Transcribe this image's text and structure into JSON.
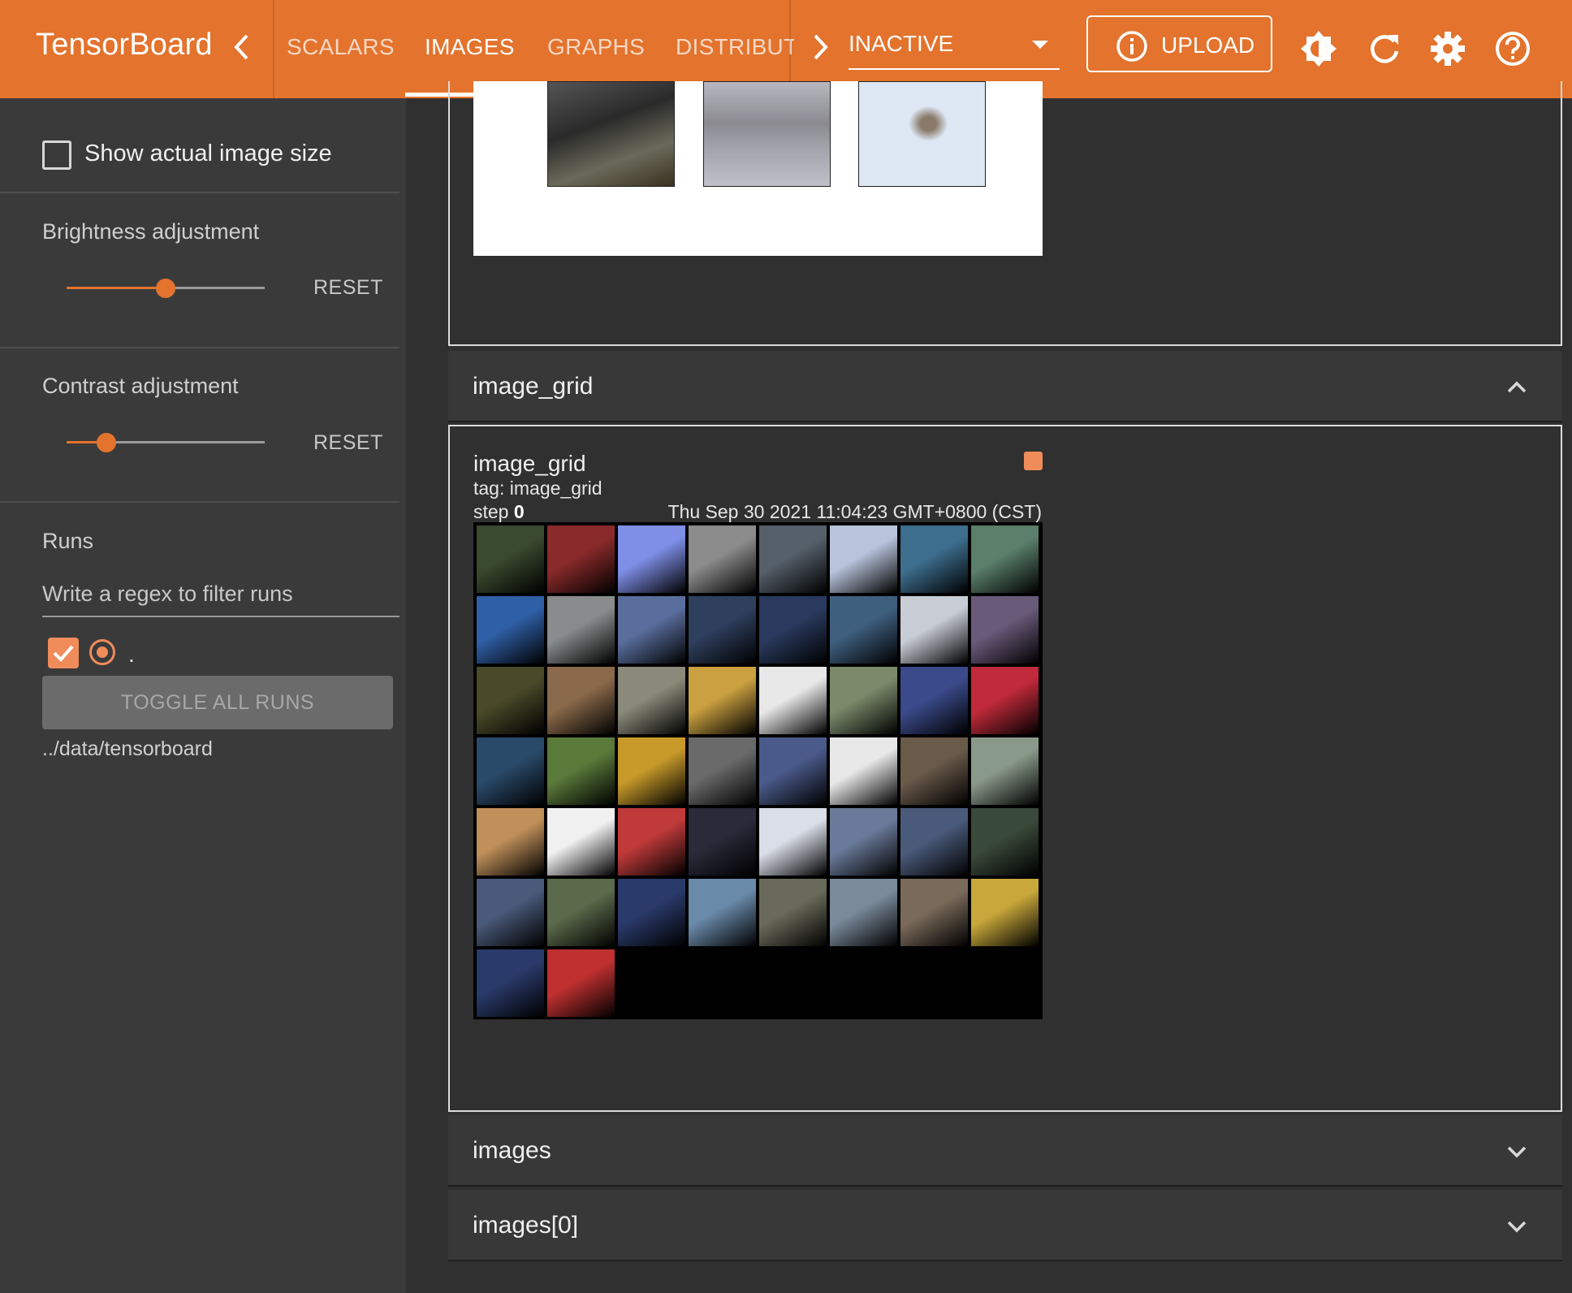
{
  "header": {
    "brand": "TensorBoard",
    "tabs": [
      {
        "label": "SCALARS",
        "active": false
      },
      {
        "label": "IMAGES",
        "active": true
      },
      {
        "label": "GRAPHS",
        "active": false
      },
      {
        "label": "DISTRIBUTI",
        "active": false
      }
    ],
    "run_status": "INACTIVE",
    "upload_label": "UPLOAD",
    "icons": [
      "chevron-left-icon",
      "chevron-right-icon",
      "info-icon",
      "brightness-icon",
      "refresh-icon",
      "settings-icon",
      "help-icon"
    ],
    "accent_color": "#e3732d"
  },
  "sidebar": {
    "show_actual_size_label": "Show actual image size",
    "show_actual_size_checked": false,
    "brightness": {
      "label": "Brightness adjustment",
      "reset_label": "RESET",
      "level": 0.5
    },
    "contrast": {
      "label": "Contrast adjustment",
      "reset_label": "RESET",
      "level": 0.2
    },
    "runs": {
      "label": "Runs",
      "filter_placeholder": "Write a regex to filter runs",
      "items": [
        {
          "name": ".",
          "checked": true
        }
      ],
      "toggle_all_label": "TOGGLE ALL RUNS",
      "log_dir": "../data/tensorboard"
    }
  },
  "main": {
    "sections": [
      {
        "title": "image_grid",
        "expanded": true
      },
      {
        "title": "images",
        "expanded": false
      },
      {
        "title": "images[0]",
        "expanded": false
      }
    ],
    "card": {
      "title": "image_grid",
      "tag": "tag: image_grid",
      "step_label": "step",
      "step_value": "0",
      "timestamp": "Thu Sep 30 2021 11:04:23 GMT+0800 (CST)"
    },
    "grid_tile_colors": [
      "#3a4a2e",
      "#8a2a2a",
      "#7f8fe8",
      "#8c8c8c",
      "#55606a",
      "#b8c4dc",
      "#3d6e8e",
      "#5a7f6a",
      "#2f5fa6",
      "#888c8c",
      "#5a6e9e",
      "#2f3f5e",
      "#2a3a5e",
      "#3f5f7f",
      "#c8ccd4",
      "#6a5a7a",
      "#4a4a2a",
      "#8a6a4a",
      "#8a8a7a",
      "#caa040",
      "#e8e8e8",
      "#7a8a6a",
      "#3a4a8a",
      "#c02a3a",
      "#2a4a6a",
      "#5a7a3a",
      "#c89a2a",
      "#6a6a6a",
      "#4a5a8a",
      "#e8e8e8",
      "#6a5a4a",
      "#8a9a8a",
      "#c0905a",
      "#f0f0f0",
      "#c03a3a",
      "#2a2a3a",
      "#dadee8",
      "#6a7a9a",
      "#4a5a7a",
      "#3a4a3a",
      "#4a5a7a",
      "#5a6a4a",
      "#2a3a6a",
      "#6a8aaa",
      "#6a6a5a",
      "#7a8a9a",
      "#7a6a5a",
      "#c8a83a",
      "#2a3a6a",
      "#c03030"
    ]
  }
}
